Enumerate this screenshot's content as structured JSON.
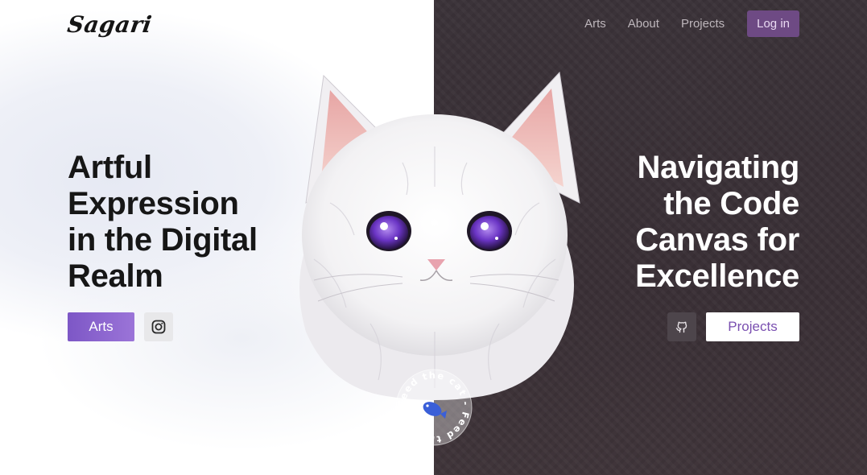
{
  "header": {
    "logo": "Sagari",
    "nav": [
      {
        "label": "Arts"
      },
      {
        "label": "About"
      },
      {
        "label": "Projects"
      }
    ],
    "login_label": "Log in"
  },
  "left": {
    "heading_lines": [
      "Artful",
      "Expression",
      "in the Digital",
      "Realm"
    ],
    "primary_button": "Arts",
    "social_icon": "instagram-icon"
  },
  "right": {
    "heading_lines": [
      "Navigating",
      "the Code",
      "Canvas for",
      "Excellence"
    ],
    "primary_button": "Projects",
    "social_icon": "github-icon"
  },
  "feed_badge": {
    "text": "Feed the cat - Feed the cat - ",
    "icon": "fish-icon"
  },
  "colors": {
    "accent": "#8a63cf",
    "dark_bg": "#3a3238",
    "login_bg": "#6e4a84"
  }
}
